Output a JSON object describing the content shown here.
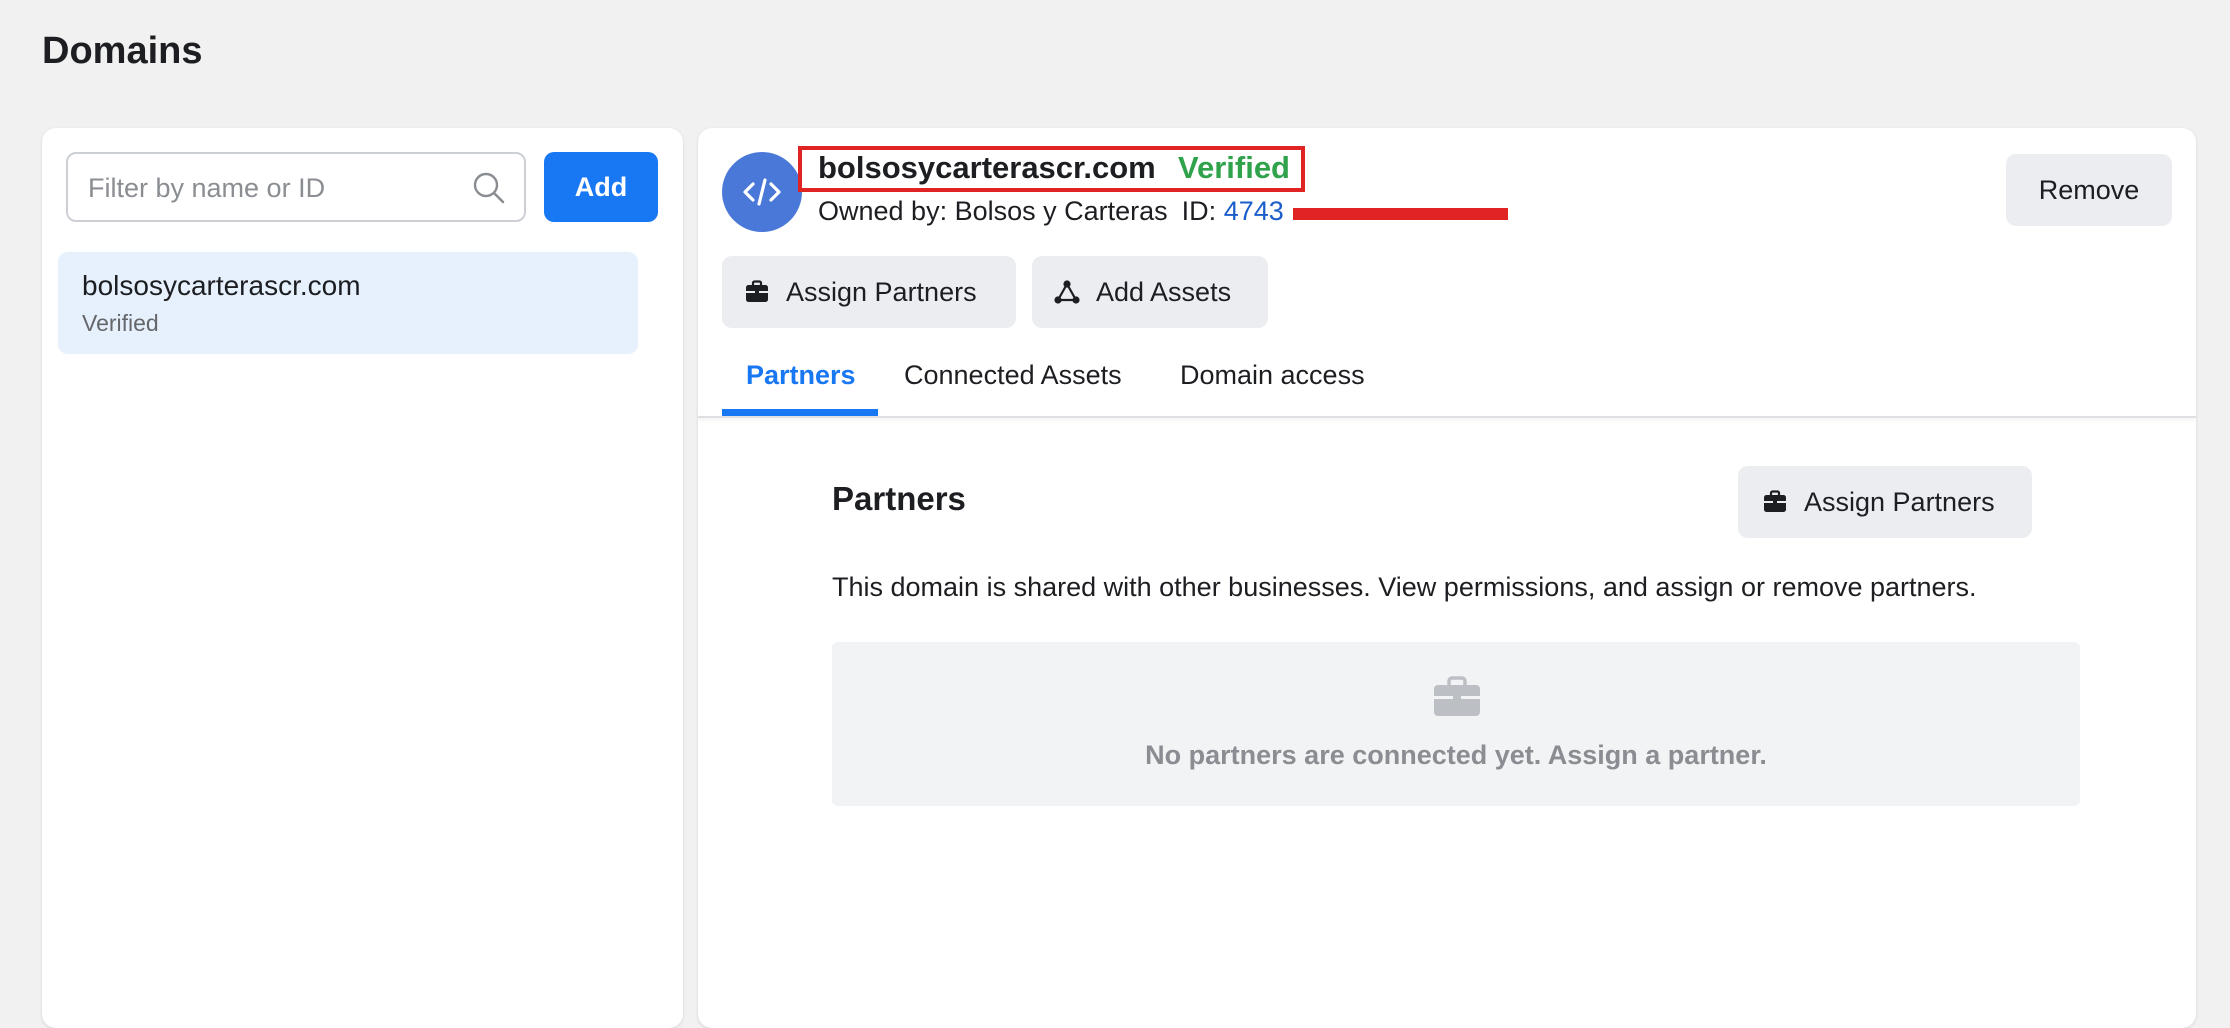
{
  "page": {
    "title": "Domains"
  },
  "left_panel": {
    "filter": {
      "placeholder": "Filter by name or ID",
      "value": ""
    },
    "add_label": "Add",
    "domains": [
      {
        "name": "bolsosycarterascr.com",
        "status": "Verified"
      }
    ]
  },
  "detail": {
    "domain": "bolsosycarterascr.com",
    "status": "Verified",
    "owner_label": "Owned by: Bolsos y Carteras",
    "id_label": "ID:",
    "id_value": "4743",
    "remove_label": "Remove",
    "actions": {
      "assign_partners": "Assign Partners",
      "add_assets": "Add Assets"
    },
    "tabs": [
      "Partners",
      "Connected Assets",
      "Domain access"
    ],
    "active_tab": "Partners"
  },
  "partners_section": {
    "title": "Partners",
    "assign_label": "Assign Partners",
    "description": "This domain is shared with other businesses. View permissions, and assign or remove partners.",
    "empty_text": "No partners are connected yet. Assign a partner."
  },
  "colors": {
    "accent": "#1877f2",
    "verified": "#31a24c",
    "highlight": "#e02424",
    "id_link": "#1b5ec9"
  },
  "icons": [
    "search-icon",
    "code-icon",
    "briefcase-icon",
    "network-icon"
  ]
}
